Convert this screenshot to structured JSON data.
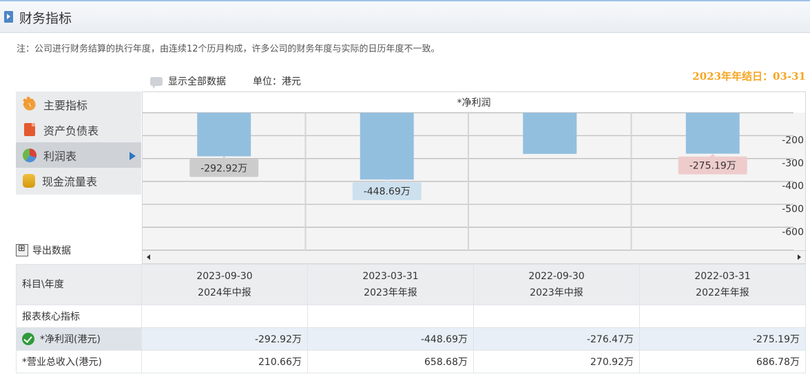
{
  "header": {
    "title": "财务指标"
  },
  "note": "注：公司进行财务结算的执行年度，由连续12个历月构成，许多公司的财务年度与实际的日历年度不一致。",
  "toolbar": {
    "show_all": "显示全部数据",
    "unit": "单位：港元",
    "fiscal_year_end": "2023年年结日：03-31"
  },
  "menu": {
    "items": [
      {
        "label": "主要指标",
        "icon": "flower-icon"
      },
      {
        "label": "资产负债表",
        "icon": "document-icon"
      },
      {
        "label": "利润表",
        "icon": "pie-chart-icon",
        "active": true
      },
      {
        "label": "现金流量表",
        "icon": "coins-icon"
      }
    ]
  },
  "export_label": "导出数据",
  "chart_data": {
    "type": "bar",
    "title": "*净利润",
    "categories": [
      "2023-09-30",
      "2023-03-31",
      "2022-09-30",
      "2022-03-31"
    ],
    "values": [
      -292.92,
      -448.69,
      -276.47,
      -275.19
    ],
    "data_labels": [
      "-292.92万",
      "-448.69万",
      "",
      "-275.19万"
    ],
    "label_colors": [
      "#cccccc",
      "#cde0ee",
      "",
      "#efcccc"
    ],
    "yticks": [
      -200,
      -300,
      -400,
      -500,
      -600
    ],
    "ytick_labels": [
      "-200",
      "-300",
      "-400",
      "-500",
      "-600"
    ],
    "ylim": [
      -700,
      0
    ],
    "bar_color": "#93bfdf",
    "grid": true
  },
  "table": {
    "corner": "科目\\年度",
    "columns": [
      {
        "date": "2023-09-30",
        "report": "2024年中报"
      },
      {
        "date": "2023-03-31",
        "report": "2023年年报"
      },
      {
        "date": "2022-09-30",
        "report": "2023年中报"
      },
      {
        "date": "2022-03-31",
        "report": "2022年年报"
      }
    ],
    "section": "报表核心指标",
    "rows": [
      {
        "label": "*净利润(港元)",
        "values": [
          "-292.92万",
          "-448.69万",
          "-276.47万",
          "-275.19万"
        ]
      },
      {
        "label": "*营业总收入(港元)",
        "values": [
          "210.66万",
          "658.68万",
          "270.92万",
          "686.78万"
        ]
      }
    ]
  }
}
